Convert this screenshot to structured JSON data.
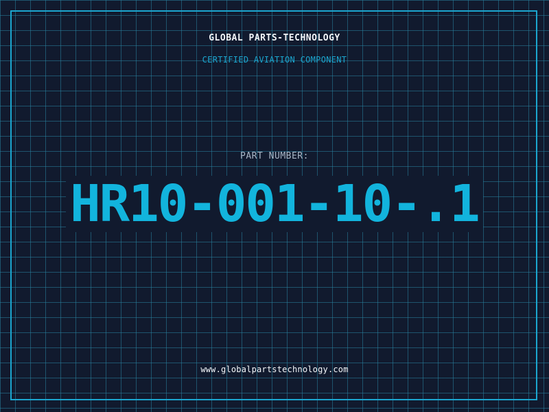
{
  "header": {
    "company": "GLOBAL PARTS-TECHNOLOGY",
    "tagline": "CERTIFIED AVIATION COMPONENT"
  },
  "part": {
    "label": "PART NUMBER:",
    "number": "HR10-001-10-.1"
  },
  "footer": {
    "website": "www.globalpartstechnology.com"
  },
  "colors": {
    "background": "#111a2e",
    "grid": "#28829f",
    "accent": "#1ba6cf",
    "part_number": "#12b4dd",
    "text": "#f2f5f8",
    "muted_text": "#a9b6c6"
  }
}
